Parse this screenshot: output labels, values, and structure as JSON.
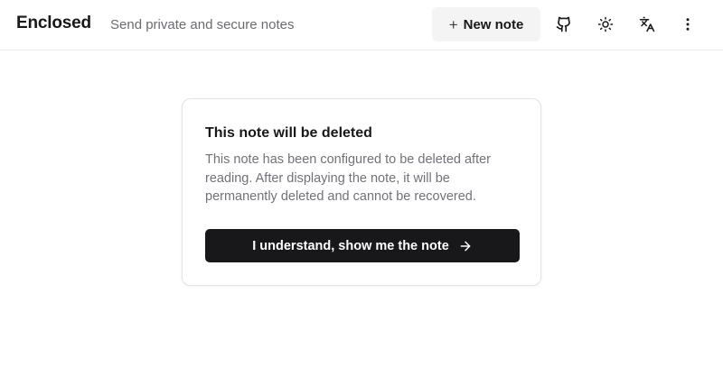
{
  "header": {
    "app_title": "Enclosed",
    "tagline": "Send private and secure notes",
    "new_note_label": "New note",
    "icons": [
      "plus-icon",
      "github-icon",
      "sun-icon",
      "translate-icon",
      "more-vertical-icon"
    ]
  },
  "notice": {
    "title": "This note will be deleted",
    "description": "This note has been configured to be deleted after reading. After displaying the note, it will be permanently deleted and cannot be recovered.",
    "button_label": "I understand, show me the note",
    "button_icon": "arrow-right-icon"
  },
  "colors": {
    "primary_button": "#18181b",
    "secondary_button": "#f4f4f5",
    "muted_text": "#71717a",
    "border": "#e4e4e7"
  }
}
